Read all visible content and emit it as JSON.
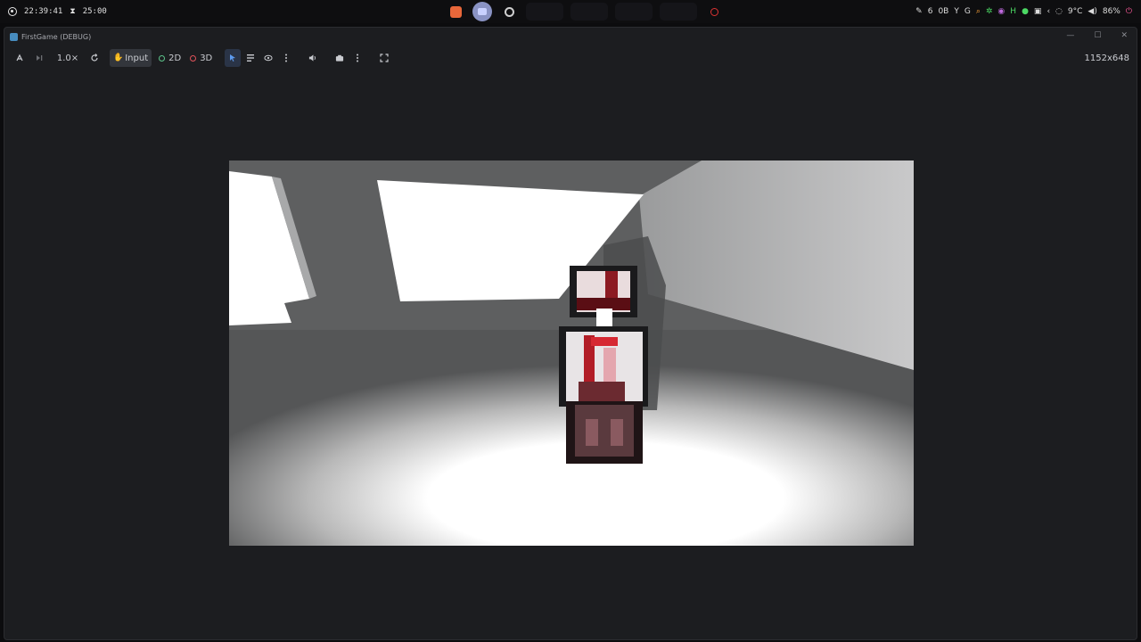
{
  "system_bar": {
    "clock": "22:39:41",
    "timer": "25:00",
    "weather": "9°C",
    "volume": "86%",
    "workspace_label": "0B"
  },
  "window": {
    "title": "FirstGame (DEBUG)"
  },
  "toolbar": {
    "speed_label": "1.0×",
    "input_label": "Input",
    "mode_2d_label": "2D",
    "mode_3d_label": "3D",
    "resolution_label": "1152x648"
  },
  "icons": {
    "record": "record-icon",
    "hourglass": "hourglass-icon",
    "remote": "remote-debug-icon",
    "step": "next-frame-icon",
    "reset": "reset-speed-icon",
    "pointer": "select-pointer-icon",
    "list": "list-icon",
    "eye": "visibility-icon",
    "more": "more-icon",
    "speaker": "speaker-icon",
    "camera": "camera-icon",
    "fullscreen": "fullscreen-icon"
  },
  "colors": {
    "accent_blue": "#5d9bf0",
    "mode_2d": "#5cc48a",
    "mode_3d": "#e0525a",
    "godot_blue": "#478cbf"
  }
}
